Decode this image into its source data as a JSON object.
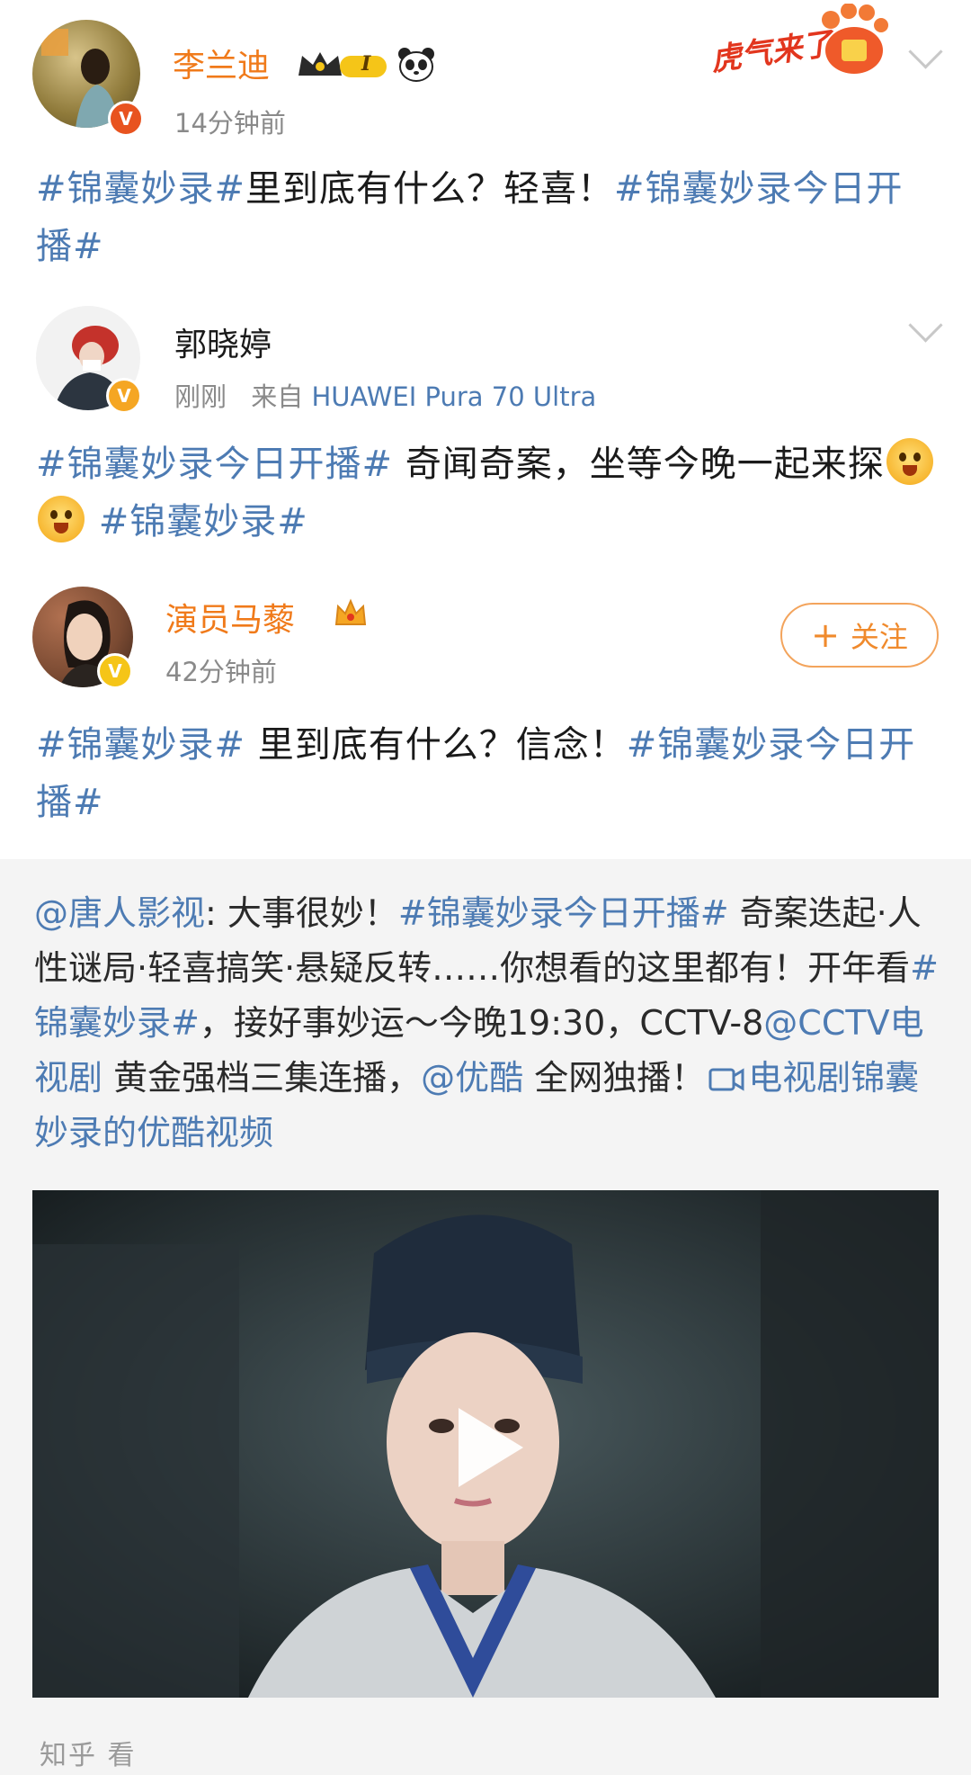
{
  "posts": [
    {
      "name": "李兰迪",
      "time": "14分钟前",
      "level_badge": "I",
      "content": {
        "tag1": "#锦囊妙录#",
        "text1": "里到底有什么？轻喜！",
        "tag2": "#锦囊妙录今日开播#"
      }
    },
    {
      "name": "郭晓婷",
      "time": "刚刚",
      "source_prefix": "来自",
      "source": "HUAWEI Pura 70 Ultra",
      "content": {
        "tag1": "#锦囊妙录今日开播#",
        "text1": " 奇闻奇案，坐等今晚一起来探",
        "tag2": "#锦囊妙录#"
      }
    },
    {
      "name": "演员马藜",
      "time": "42分钟前",
      "follow_label": "关注",
      "follow_plus": "+",
      "content": {
        "tag1": "#锦囊妙录#",
        "text1": " 里到底有什么？信念！",
        "tag2": "#锦囊妙录今日开播#"
      }
    }
  ],
  "banner_text": "虎气来了",
  "repost": {
    "mention1": "@唐人影视",
    "text1": ": 大事很妙！",
    "tag1": "#锦囊妙录今日开播#",
    "text2": " 奇案迭起·人性谜局·轻喜搞笑·悬疑反转……你想看的这里都有！开年看",
    "tag2": "#锦囊妙录#",
    "text3": "，接好事妙运～今晚19:30，CCTV-8",
    "mention2": "@CCTV电视剧",
    "text4": " 黄金强档三集连播，",
    "mention3": "@优酷",
    "text5": " 全网独播！",
    "video_link": "电视剧锦囊妙录的优酷视频"
  },
  "watermark": "知乎 看",
  "colors": {
    "link": "#4d7bb3",
    "verified_red": "#e8531f",
    "verified_orange": "#f5a623",
    "follow": "#f08a2c"
  }
}
